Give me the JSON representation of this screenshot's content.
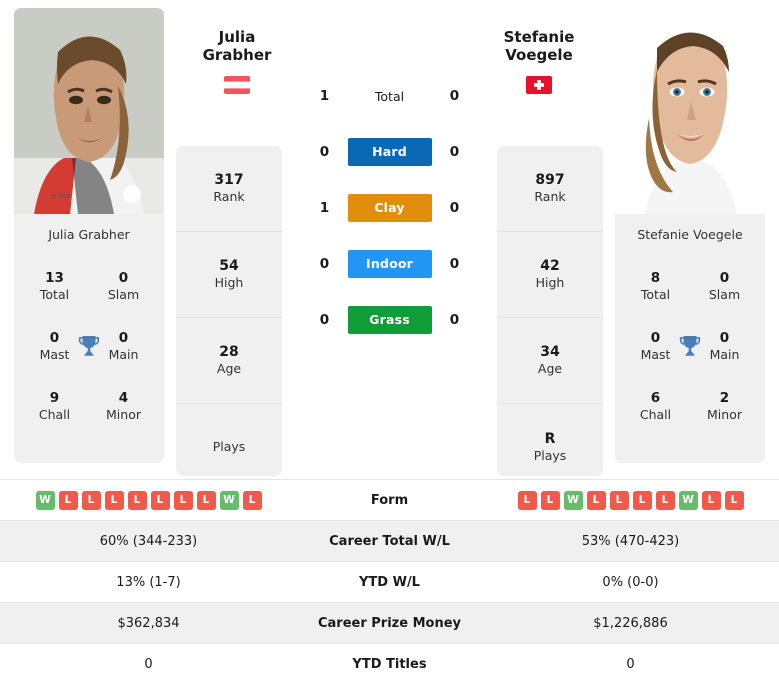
{
  "players": {
    "left": {
      "first_name": "Julia",
      "last_name": "Grabher",
      "full_name": "Julia Grabher",
      "country_flag": "austria-flag",
      "rank": "317",
      "rank_label": "Rank",
      "high": "54",
      "high_label": "High",
      "age": "28",
      "age_label": "Age",
      "plays": "",
      "plays_label": "Plays",
      "titles": {
        "total": "13",
        "total_label": "Total",
        "slam": "0",
        "slam_label": "Slam",
        "mast": "0",
        "mast_label": "Mast",
        "main": "0",
        "main_label": "Main",
        "chall": "9",
        "chall_label": "Chall",
        "minor": "4",
        "minor_label": "Minor"
      },
      "form": [
        "W",
        "L",
        "L",
        "L",
        "L",
        "L",
        "L",
        "L",
        "W",
        "L"
      ],
      "career_total_wl": "60% (344-233)",
      "ytd_wl": "13% (1-7)",
      "career_prize_money": "$362,834",
      "ytd_titles": "0"
    },
    "right": {
      "first_name": "Stefanie",
      "last_name": "Voegele",
      "full_name": "Stefanie Voegele",
      "country_flag": "switzerland-flag",
      "rank": "897",
      "rank_label": "Rank",
      "high": "42",
      "high_label": "High",
      "age": "34",
      "age_label": "Age",
      "plays": "R",
      "plays_label": "Plays",
      "titles": {
        "total": "8",
        "total_label": "Total",
        "slam": "0",
        "slam_label": "Slam",
        "mast": "0",
        "mast_label": "Mast",
        "main": "0",
        "main_label": "Main",
        "chall": "6",
        "chall_label": "Chall",
        "minor": "2",
        "minor_label": "Minor"
      },
      "form": [
        "L",
        "L",
        "W",
        "L",
        "L",
        "L",
        "L",
        "W",
        "L",
        "L"
      ],
      "career_total_wl": "53% (470-423)",
      "ytd_wl": "0% (0-0)",
      "career_prize_money": "$1,226,886",
      "ytd_titles": "0"
    }
  },
  "head_to_head": {
    "total": {
      "label": "Total",
      "left": "1",
      "right": "0"
    },
    "surfaces": [
      {
        "label": "Hard",
        "left": "0",
        "right": "0",
        "color": "#0b69b3"
      },
      {
        "label": "Clay",
        "left": "1",
        "right": "0",
        "color": "#e08e0b"
      },
      {
        "label": "Indoor",
        "left": "0",
        "right": "0",
        "color": "#2196f3"
      },
      {
        "label": "Grass",
        "left": "0",
        "right": "0",
        "color": "#0f9d3a"
      }
    ]
  },
  "table": {
    "rows": [
      {
        "label": "Form"
      },
      {
        "label": "Career Total W/L"
      },
      {
        "label": "YTD W/L"
      },
      {
        "label": "Career Prize Money"
      },
      {
        "label": "YTD Titles"
      }
    ]
  },
  "colors": {
    "card_bg": "#f0f0f0",
    "win_badge": "#67bb6a",
    "loss_badge": "#f0594c",
    "trophy": "#4a7ebb",
    "austria_red": "#f2545b",
    "swiss_red": "#e8112d"
  }
}
